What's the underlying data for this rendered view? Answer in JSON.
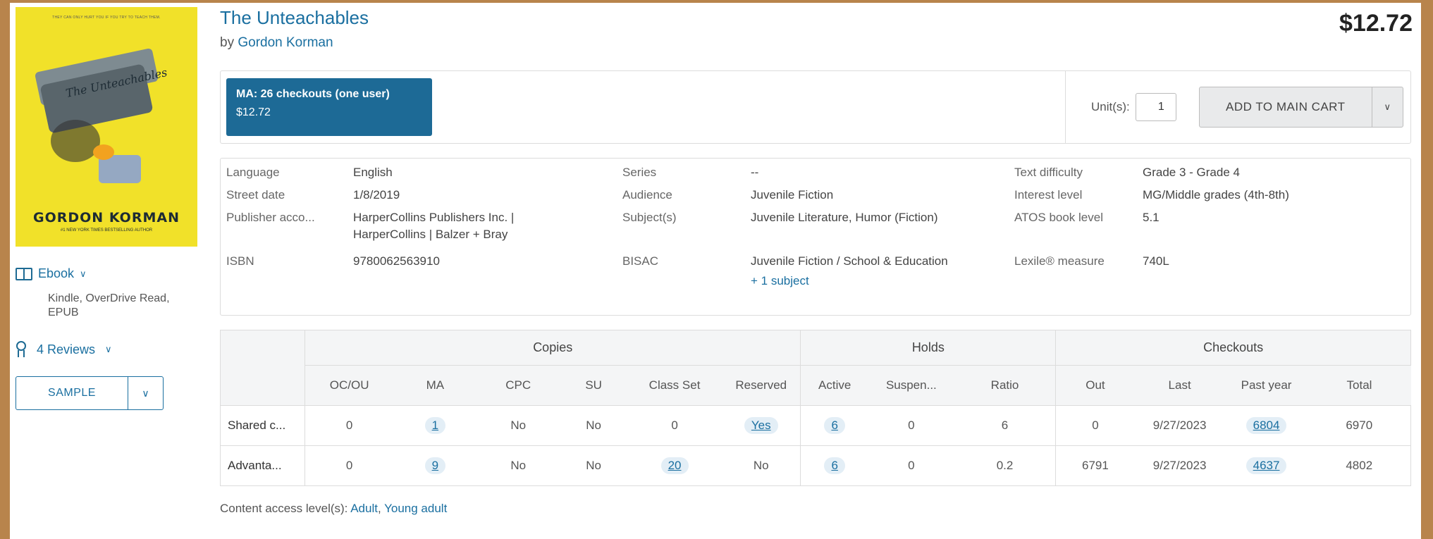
{
  "cover": {
    "tagline": "THEY CAN ONLY HURT YOU IF YOU TRY TO TEACH THEM.",
    "art_title": "The Unteachables",
    "author": "GORDON KORMAN",
    "subtitle": "#1 NEW YORK TIMES BESTSELLING AUTHOR"
  },
  "format": {
    "label": "Ebook",
    "icon": "book-icon",
    "details": "Kindle, OverDrive Read, EPUB"
  },
  "reviews": {
    "label": "4 Reviews",
    "icon": "award-icon"
  },
  "sample_button": "SAMPLE",
  "book": {
    "title": "The Unteachables",
    "by": "by",
    "author": "Gordon Korman",
    "price": "$12.72"
  },
  "plan": {
    "name": "MA: 26 checkouts (one user)",
    "price": "$12.72"
  },
  "cart": {
    "units_label": "Unit(s):",
    "units_value": "1",
    "add_label": "ADD TO MAIN CART"
  },
  "details": {
    "language_label": "Language",
    "language": "English",
    "street_date_label": "Street date",
    "street_date": "1/8/2019",
    "publisher_label": "Publisher acco...",
    "publisher_1": "HarperCollins Publishers Inc. |",
    "publisher_2": "HarperCollins | Balzer + Bray",
    "isbn_label": "ISBN",
    "isbn": "9780062563910",
    "series_label": "Series",
    "series": "--",
    "audience_label": "Audience",
    "audience": "Juvenile Fiction",
    "subjects_label": "Subject(s)",
    "subjects": "Juvenile Literature, Humor (Fiction)",
    "bisac_label": "BISAC",
    "bisac": "Juvenile Fiction / School & Education",
    "more_subjects": "+ 1 subject",
    "text_difficulty_label": "Text difficulty",
    "text_difficulty": "Grade 3 - Grade 4",
    "interest_label": "Interest level",
    "interest": "MG/Middle grades (4th-8th)",
    "atos_label": "ATOS book level",
    "atos": "5.1",
    "lexile_label": "Lexile® measure",
    "lexile": "740L"
  },
  "stats": {
    "groups": {
      "copies": "Copies",
      "holds": "Holds",
      "checkouts": "Checkouts"
    },
    "columns": [
      "OC/OU",
      "MA",
      "CPC",
      "SU",
      "Class Set",
      "Reserved",
      "Active",
      "Suspen...",
      "Ratio",
      "Out",
      "Last",
      "Past year",
      "Total"
    ],
    "rows": [
      {
        "name": "Shared c...",
        "cells": [
          "0",
          "1",
          "No",
          "No",
          "0",
          "Yes",
          "6",
          "0",
          "6",
          "0",
          "9/27/2023",
          "6804",
          "6970"
        ]
      },
      {
        "name": "Advanta...",
        "cells": [
          "0",
          "9",
          "No",
          "No",
          "20",
          "No",
          "6",
          "0",
          "0.2",
          "6791",
          "9/27/2023",
          "4637",
          "4802"
        ]
      }
    ]
  },
  "access": {
    "label": "Content access level(s):",
    "adult": "Adult",
    "sep": ",",
    "young_adult": "Young adult"
  }
}
